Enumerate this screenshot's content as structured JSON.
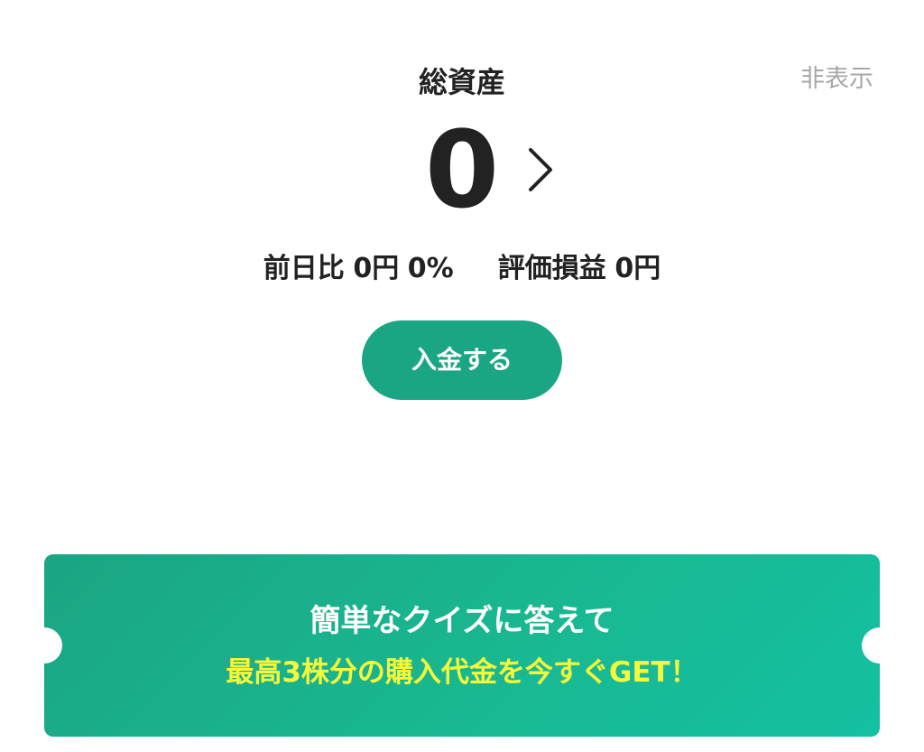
{
  "header": {
    "title": "総資産",
    "hide_label": "非表示"
  },
  "total": {
    "value": "0",
    "detail_icon": "chevron-right-icon"
  },
  "summary": {
    "day_change_label": "前日比",
    "day_change_amount": "0円",
    "day_change_percent": "0%",
    "pl_label": "評価損益",
    "pl_amount": "0円"
  },
  "deposit": {
    "label": "入金する"
  },
  "banner": {
    "line1": "簡単なクイズに答えて",
    "line2": "最高3株分の購入代金を今すぐGET！"
  },
  "colors": {
    "accent": "#1aa583",
    "banner_highlight": "#f5f83a",
    "muted": "#a7a7a7",
    "text": "#222222"
  }
}
